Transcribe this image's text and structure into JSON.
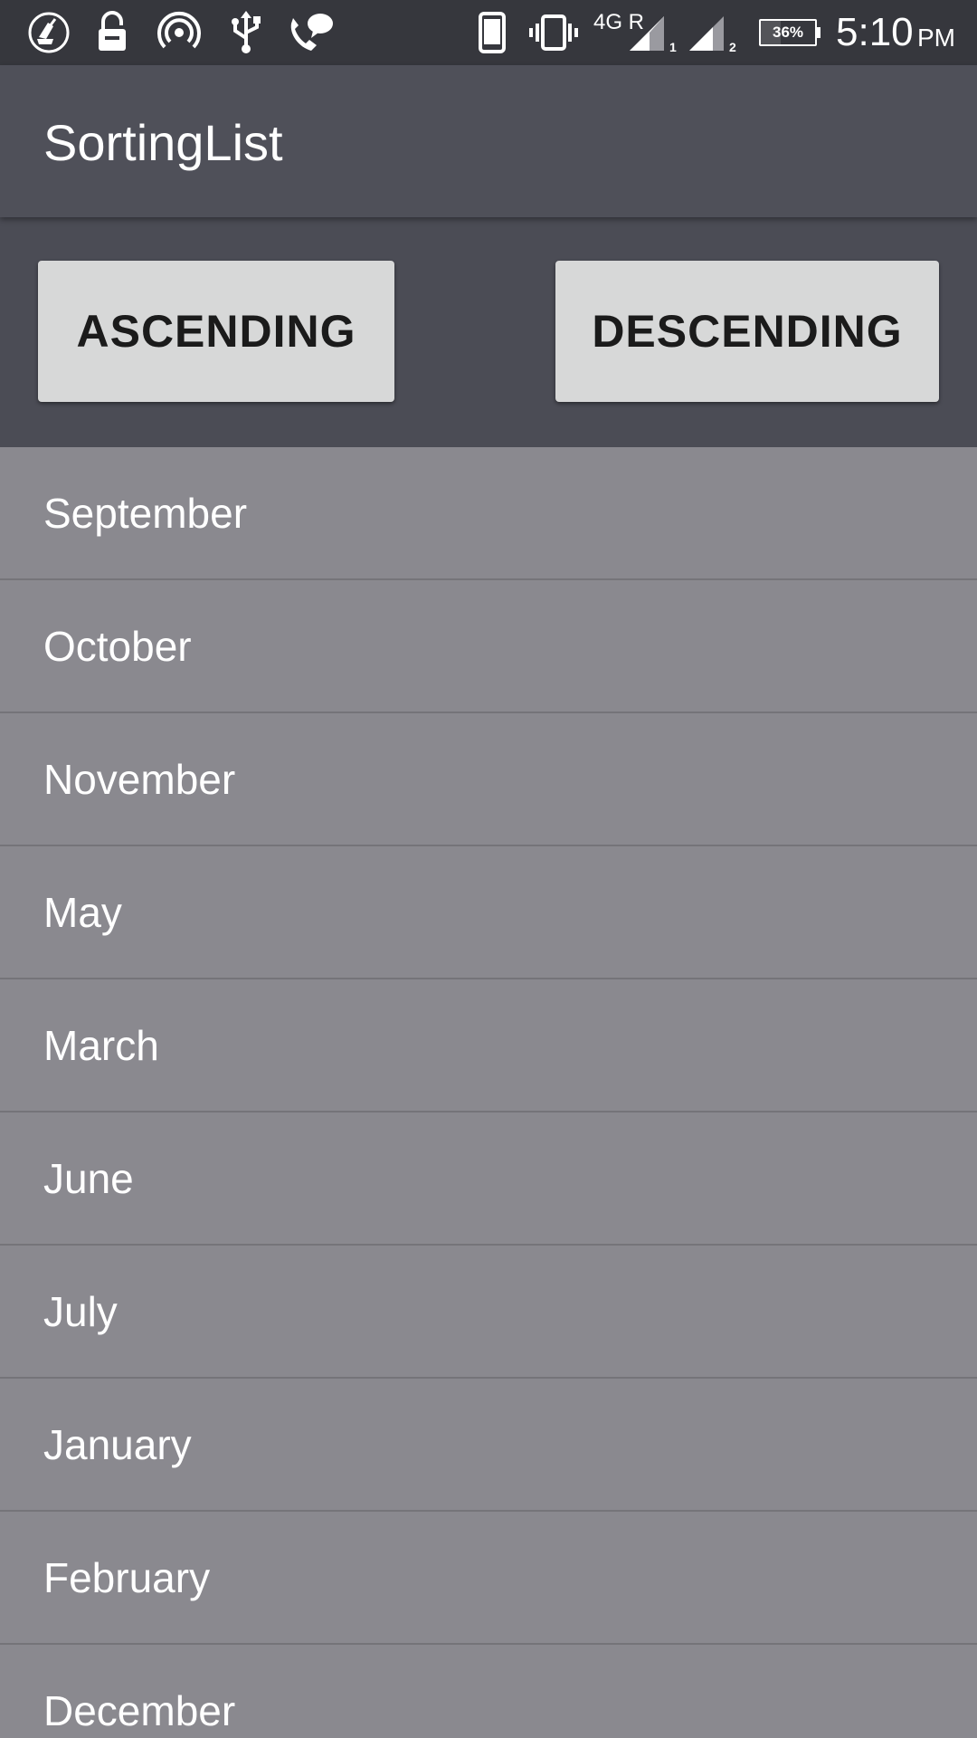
{
  "status_bar": {
    "icons_left": [
      "cleaner-icon",
      "lock-icon",
      "hotspot-icon",
      "usb-icon",
      "call-chat-icon"
    ],
    "icons_right": [
      "phone-icon",
      "vibrate-icon",
      "signal-sim1-icon",
      "signal-sim2-icon",
      "battery-icon"
    ],
    "network_label": "4G R",
    "sim1_label": "1",
    "sim2_label": "2",
    "battery_percent": "36%",
    "battery_level": 0.36,
    "time": "5:10",
    "ampm": "PM"
  },
  "app_bar": {
    "title": "SortingList"
  },
  "buttons": {
    "ascending": "ASCENDING",
    "descending": "DESCENDING"
  },
  "list": {
    "items": [
      "September",
      "October",
      "November",
      "May",
      "March",
      "June",
      "July",
      "January",
      "February",
      "December"
    ]
  },
  "colors": {
    "status_bar": "#36373d",
    "app_bar": "#4f5059",
    "button_bar": "#4b4c55",
    "button_bg": "#d7d8d8",
    "list_bg": "#8a898f",
    "divider": "#757479"
  }
}
